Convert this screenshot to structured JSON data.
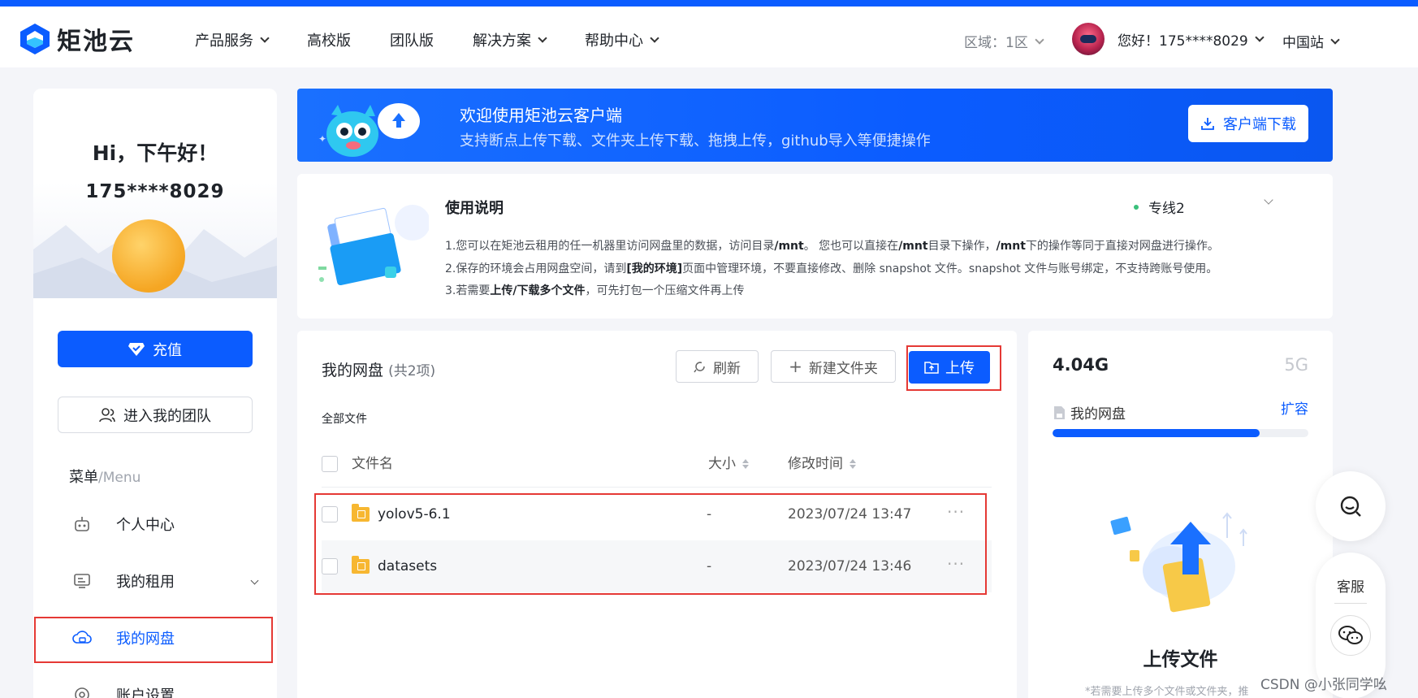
{
  "header": {
    "logo_text": "矩池云",
    "nav": [
      {
        "label": "产品服务",
        "has_dropdown": true
      },
      {
        "label": "高校版",
        "has_dropdown": false
      },
      {
        "label": "团队版",
        "has_dropdown": false
      },
      {
        "label": "解决方案",
        "has_dropdown": true
      },
      {
        "label": "帮助中心",
        "has_dropdown": true
      }
    ],
    "region": "区域：1区",
    "greeting": "您好！175****8029",
    "site": "中国站"
  },
  "sidebar": {
    "hi": "Hi，下午好！",
    "phone": "175****8029",
    "recharge_label": "充值",
    "team_label": "进入我的团队",
    "menu_title": "菜单",
    "menu_sub": "/Menu",
    "items": [
      {
        "label": "个人中心",
        "icon": "robot-icon"
      },
      {
        "label": "我的租用",
        "icon": "monitor-icon"
      },
      {
        "label": "我的网盘",
        "icon": "cloud-disk-icon",
        "active": true
      },
      {
        "label": "账户设置",
        "icon": "settings-icon"
      }
    ]
  },
  "banner": {
    "title": "欢迎使用矩池云客户端",
    "subtitle": "支持断点上传下载、文件夹上传下载、拖拽上传，github导入等便捷操作",
    "download_label": "客户端下载"
  },
  "notice": {
    "title": "使用说明",
    "line_select": "专线2",
    "line1_a": "1.您可以在矩池云租用的任一机器里访问网盘里的数据，访问目录",
    "line1_b": "/mnt",
    "line1_c": "。 您也可以直接在",
    "line1_d": "/mnt",
    "line1_e": "目录下操作，",
    "line1_f": "/mnt",
    "line1_g": "下的操作等同于直接对网盘进行操作。",
    "line2_a": "2.保存的环境会占用网盘空间，请到",
    "line2_b": "[我的环境]",
    "line2_c": "页面中管理环境，不要直接修改、删除 snapshot 文件。snapshot 文件与账号绑定，不支持跨账号使用。",
    "line3_a": "3.若需要",
    "line3_b": "上传/下载多个文件",
    "line3_c": "，可先打包一个压缩文件再上传"
  },
  "files": {
    "title": "我的网盘",
    "count": "(共2项)",
    "refresh_label": "刷新",
    "new_folder_label": "新建文件夹",
    "upload_label": "上传",
    "breadcrumb": "全部文件",
    "columns": {
      "name": "文件名",
      "size": "大小",
      "time": "修改时间"
    },
    "rows": [
      {
        "name": "yolov5-6.1",
        "size": "-",
        "time": "2023/07/24 13:47"
      },
      {
        "name": "datasets",
        "size": "-",
        "time": "2023/07/24 13:46"
      }
    ],
    "more": "···"
  },
  "storage": {
    "used": "4.04G",
    "total": "5G",
    "disk_label": "我的网盘",
    "expand_label": "扩容",
    "usage_fraction": 0.808,
    "upload_title": "上传文件",
    "upload_hint": "*若需要上传多个文件或文件夹，推"
  },
  "float": {
    "service_label": "客服"
  },
  "watermark": "CSDN @小张同学吆",
  "colors": {
    "brand": "#0b5cff",
    "highlight_box": "#e53935"
  }
}
